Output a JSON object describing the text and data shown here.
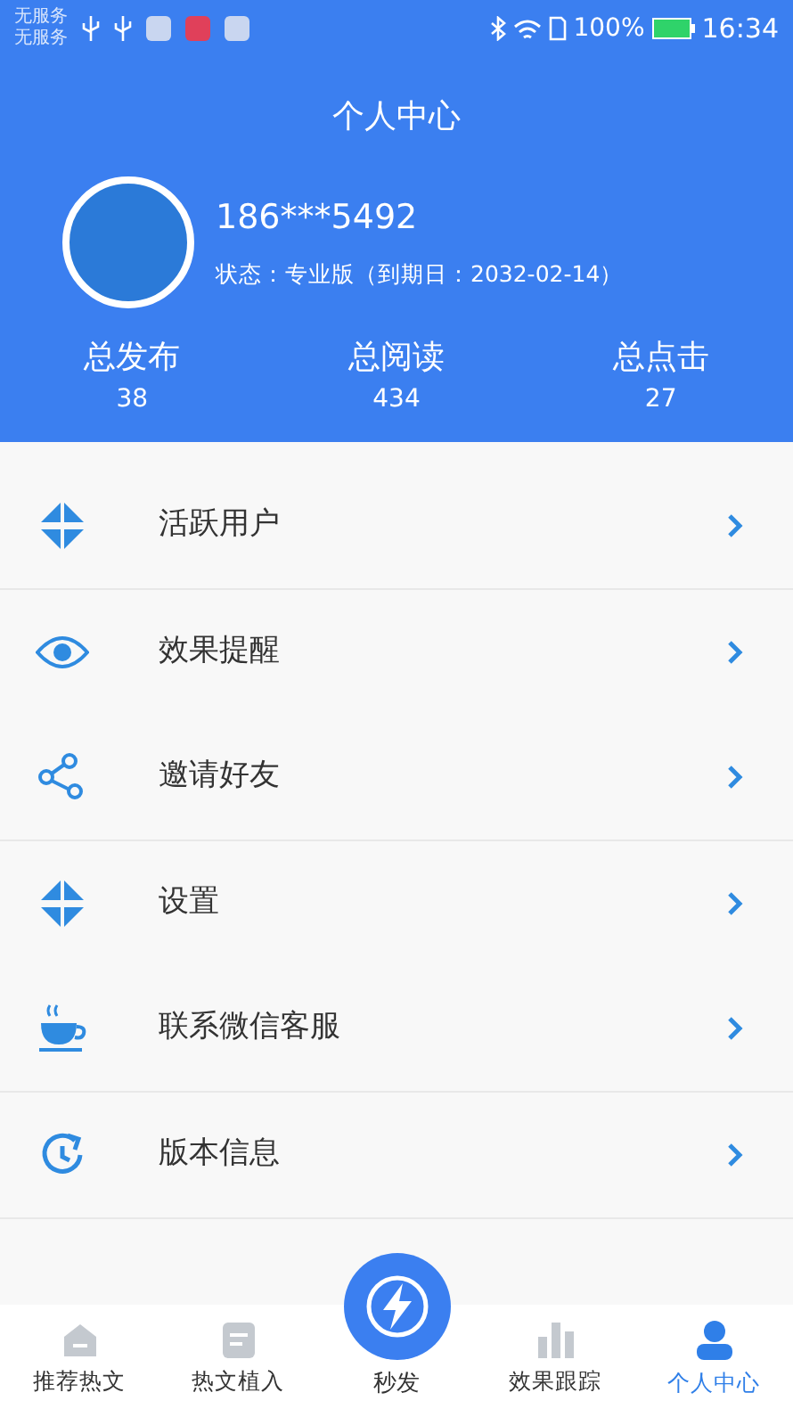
{
  "status_bar": {
    "carrier_lines": [
      "无服务",
      "无服务"
    ],
    "battery": "100%",
    "time": "16:34"
  },
  "header": {
    "title": "个人中心"
  },
  "profile": {
    "phone": "186***5492",
    "status": "状态：专业版（到期日：2032-02-14）"
  },
  "stats": [
    {
      "label": "总发布",
      "value": "38"
    },
    {
      "label": "总阅读",
      "value": "434"
    },
    {
      "label": "总点击",
      "value": "27"
    }
  ],
  "menu_groups": [
    [
      {
        "label": "活跃用户"
      }
    ],
    [
      {
        "label": "效果提醒"
      },
      {
        "label": "邀请好友"
      }
    ],
    [
      {
        "label": "设置"
      },
      {
        "label": "联系微信客服"
      }
    ],
    [
      {
        "label": "版本信息"
      }
    ]
  ],
  "tab_bar": [
    {
      "label": "推荐热文",
      "kind": "tab",
      "selected": false
    },
    {
      "label": "热文植入",
      "kind": "tab",
      "selected": false
    },
    {
      "label": "秒发",
      "kind": "fab",
      "selected": false
    },
    {
      "label": "效果跟踪",
      "kind": "tab",
      "selected": false
    },
    {
      "label": "个人中心",
      "kind": "tab",
      "selected": true
    }
  ]
}
